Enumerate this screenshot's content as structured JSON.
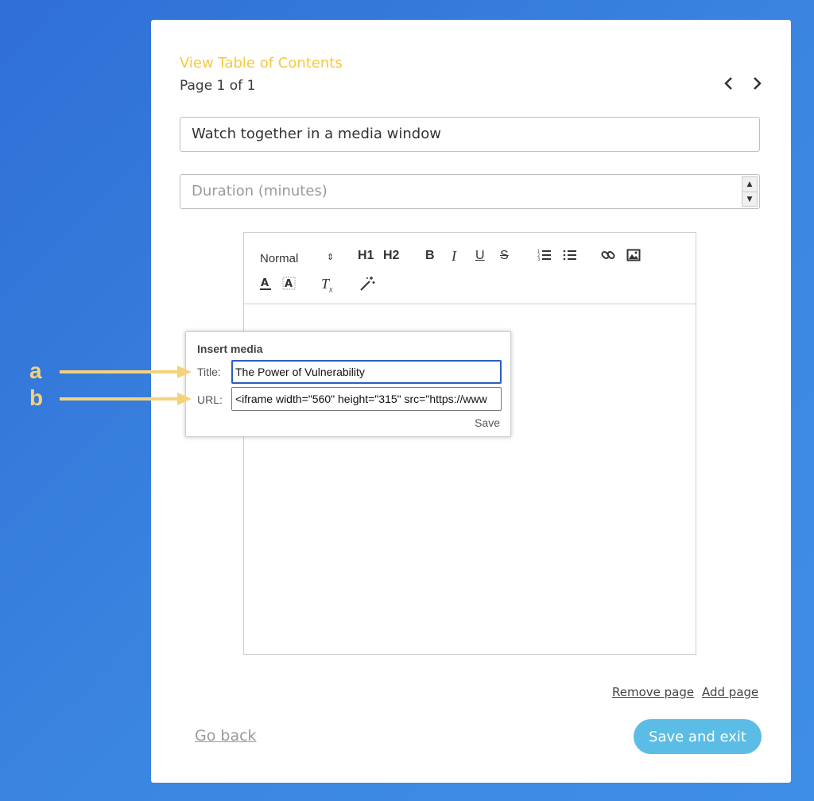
{
  "toc_link": "View Table of Contents",
  "page_info": "Page 1 of 1",
  "pager": {
    "prev_icon": "chevron-left-icon",
    "next_icon": "chevron-right-icon"
  },
  "title_field": {
    "value": "Watch together in a media window"
  },
  "duration_field": {
    "placeholder": "Duration (minutes)"
  },
  "toolbar": {
    "style_select": "Normal",
    "h1": "H1",
    "h2": "H2",
    "bold": "B",
    "italic": "I",
    "underline": "U",
    "strike": "S"
  },
  "insert_media": {
    "heading": "Insert media",
    "title_label": "Title:",
    "title_value": "The Power of Vulnerability",
    "url_label": "URL:",
    "url_value": "<iframe width=\"560\" height=\"315\" src=\"https://www",
    "save_label": "Save"
  },
  "footer": {
    "remove_page": "Remove page",
    "add_page": "Add page",
    "go_back": "Go back",
    "save_exit": "Save and exit"
  },
  "annotations": {
    "a": "a",
    "b": "b"
  },
  "colors": {
    "accent_yellow": "#f5c842",
    "button_blue": "#5bbde6",
    "background_blue": "#2f6fd6",
    "annotation_yellow": "#f5d27a"
  }
}
